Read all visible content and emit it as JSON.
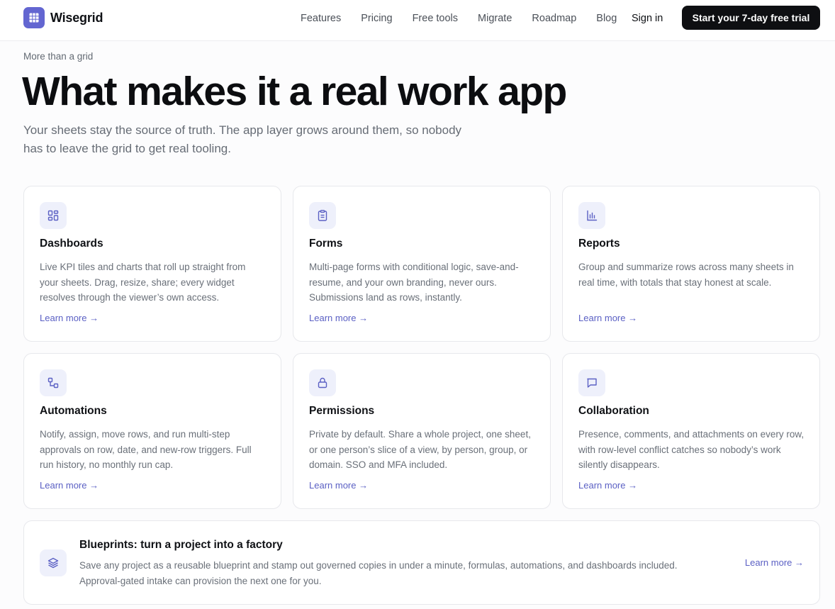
{
  "brand": {
    "name": "Wisegrid",
    "accent": "#6366d1"
  },
  "nav": {
    "items": [
      "Features",
      "Pricing",
      "Free tools",
      "Migrate",
      "Roadmap",
      "Blog"
    ],
    "signin": "Sign in",
    "cta": "Start your 7-day free trial"
  },
  "hero": {
    "eyebrow": "More than a grid",
    "title": "What makes it a real work app",
    "subtitle": "Your sheets stay the source of truth. The app layer grows around them, so nobody has to leave the grid to get real tooling."
  },
  "cards": [
    {
      "icon": "dashboard-icon",
      "title": "Dashboards",
      "desc": "Live KPI tiles and charts that roll up straight from your sheets. Drag, resize, share; every widget resolves through the viewer’s own access.",
      "link": "Learn more →"
    },
    {
      "icon": "clipboard-icon",
      "title": "Forms",
      "desc": "Multi-page forms with conditional logic, save-and-resume, and your own branding, never ours. Submissions land as rows, instantly.",
      "link": "Learn more →"
    },
    {
      "icon": "bar-chart-icon",
      "title": "Reports",
      "desc": "Group and summarize rows across many sheets in real time, with totals that stay honest at scale.",
      "link": "Learn more →"
    },
    {
      "icon": "workflow-icon",
      "title": "Automations",
      "desc": "Notify, assign, move rows, and run multi-step approvals on row, date, and new-row triggers. Full run history, no monthly run cap.",
      "link": "Learn more →"
    },
    {
      "icon": "lock-icon",
      "title": "Permissions",
      "desc": "Private by default. Share a whole project, one sheet, or one person’s slice of a view, by person, group, or domain. SSO and MFA included.",
      "link": "Learn more →"
    },
    {
      "icon": "chat-icon",
      "title": "Collaboration",
      "desc": "Presence, comments, and attachments on every row, with row-level conflict catches so nobody’s work silently disappears.",
      "link": "Learn more →"
    }
  ],
  "banner": {
    "icon": "layers-icon",
    "title": "Blueprints: turn a project into a factory",
    "desc": "Save any project as a reusable blueprint and stamp out governed copies in under a minute, formulas, automations, and dashboards included. Approval-gated intake can provision the next one for you.",
    "link": "Learn more →"
  }
}
